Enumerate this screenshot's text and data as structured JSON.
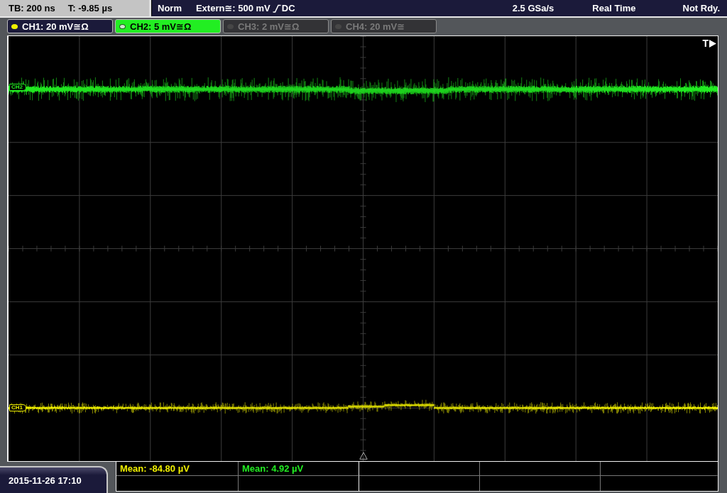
{
  "status_bar": {
    "timebase": "TB: 200 ns",
    "trigger_offset": "T: -9.85 µs",
    "trigger_mode": "Norm",
    "trigger_source": "Extern≅: 500 mV",
    "trigger_coupling": "DC",
    "sample_rate": "2.5 GSa/s",
    "acquisition": "Real Time",
    "status": "Not Rdy."
  },
  "channels": [
    {
      "label": "CH1: 20 mV≅Ω",
      "selected": false,
      "on": true,
      "color": "#f0f000"
    },
    {
      "label": "CH2: 5 mV≅Ω",
      "selected": true,
      "on": true,
      "color": "#22ee22"
    },
    {
      "label": "CH3: 2 mV≅Ω",
      "selected": false,
      "on": false,
      "color": "#474747"
    },
    {
      "label": "CH4: 20 mV≅",
      "selected": false,
      "on": false,
      "color": "#474747"
    }
  ],
  "plot": {
    "trigger_marker": "T",
    "traces": [
      {
        "marker": "CH2",
        "color": "#22ee22"
      },
      {
        "marker": "CH1",
        "color": "#f0f000"
      }
    ]
  },
  "measurements": [
    {
      "text": "Mean: -84.80 µV",
      "color": "#f0f000"
    },
    {
      "text": "Mean: 4.92 µV",
      "color": "#22ee22"
    }
  ],
  "timestamp": "2015-11-26 17:10"
}
